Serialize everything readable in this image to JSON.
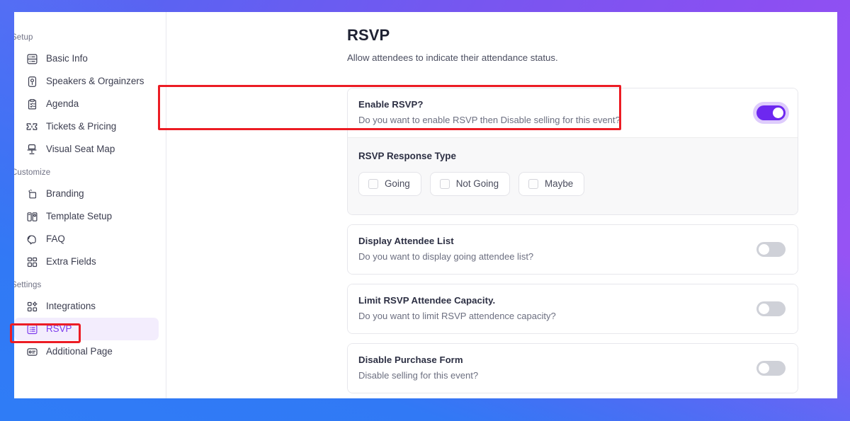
{
  "theme": {
    "accent": "#7c3aed",
    "toggle_on": "#6d28f0",
    "toggle_off": "#cfd1d8",
    "annotation": "#ec1c24",
    "active_nav_bg": "#f3edfd",
    "frame_gradient_from": "#3179f5",
    "frame_gradient_to": "#9b55f5"
  },
  "sidebar": {
    "sections": [
      {
        "label": "Setup",
        "items": [
          {
            "label": "Basic Info",
            "icon": "basic-info-icon",
            "active": false
          },
          {
            "label": "Speakers & Orgainzers",
            "icon": "speakers-icon",
            "active": false
          },
          {
            "label": "Agenda",
            "icon": "agenda-icon",
            "active": false
          },
          {
            "label": "Tickets & Pricing",
            "icon": "ticket-icon",
            "active": false
          },
          {
            "label": "Visual Seat Map",
            "icon": "seat-map-icon",
            "active": false
          }
        ]
      },
      {
        "label": "Customize",
        "items": [
          {
            "label": "Branding",
            "icon": "branding-icon",
            "active": false
          },
          {
            "label": "Template Setup",
            "icon": "template-setup-icon",
            "active": false
          },
          {
            "label": "FAQ",
            "icon": "faq-icon",
            "active": false
          },
          {
            "label": "Extra Fields",
            "icon": "extra-fields-icon",
            "active": false
          }
        ]
      },
      {
        "label": "Settings",
        "items": [
          {
            "label": "Integrations",
            "icon": "integrations-icon",
            "active": false
          },
          {
            "label": "RSVP",
            "icon": "rsvp-icon",
            "active": true
          },
          {
            "label": "Additional Page",
            "icon": "additional-page-icon",
            "active": false
          }
        ]
      }
    ]
  },
  "main": {
    "title": "RSVP",
    "subtitle": "Allow attendees to indicate their attendance status.",
    "enable_card": {
      "title": "Enable RSVP?",
      "description": "Do you want to enable RSVP then Disable selling for this event?",
      "toggle_state": "on",
      "highlighted": true
    },
    "response_type": {
      "title": "RSVP Response Type",
      "options": [
        {
          "label": "Going",
          "checked": false
        },
        {
          "label": "Not Going",
          "checked": false
        },
        {
          "label": "Maybe",
          "checked": false
        }
      ]
    },
    "setting_cards": [
      {
        "title": "Display Attendee List",
        "description": "Do you want to display going attendee list?",
        "toggle_state": "off"
      },
      {
        "title": "Limit RSVP Attendee Capacity.",
        "description": "Do you want to limit RSVP attendence capacity?",
        "toggle_state": "off"
      },
      {
        "title": "Disable Purchase Form",
        "description": "Disable selling for this event?",
        "toggle_state": "off"
      }
    ]
  }
}
